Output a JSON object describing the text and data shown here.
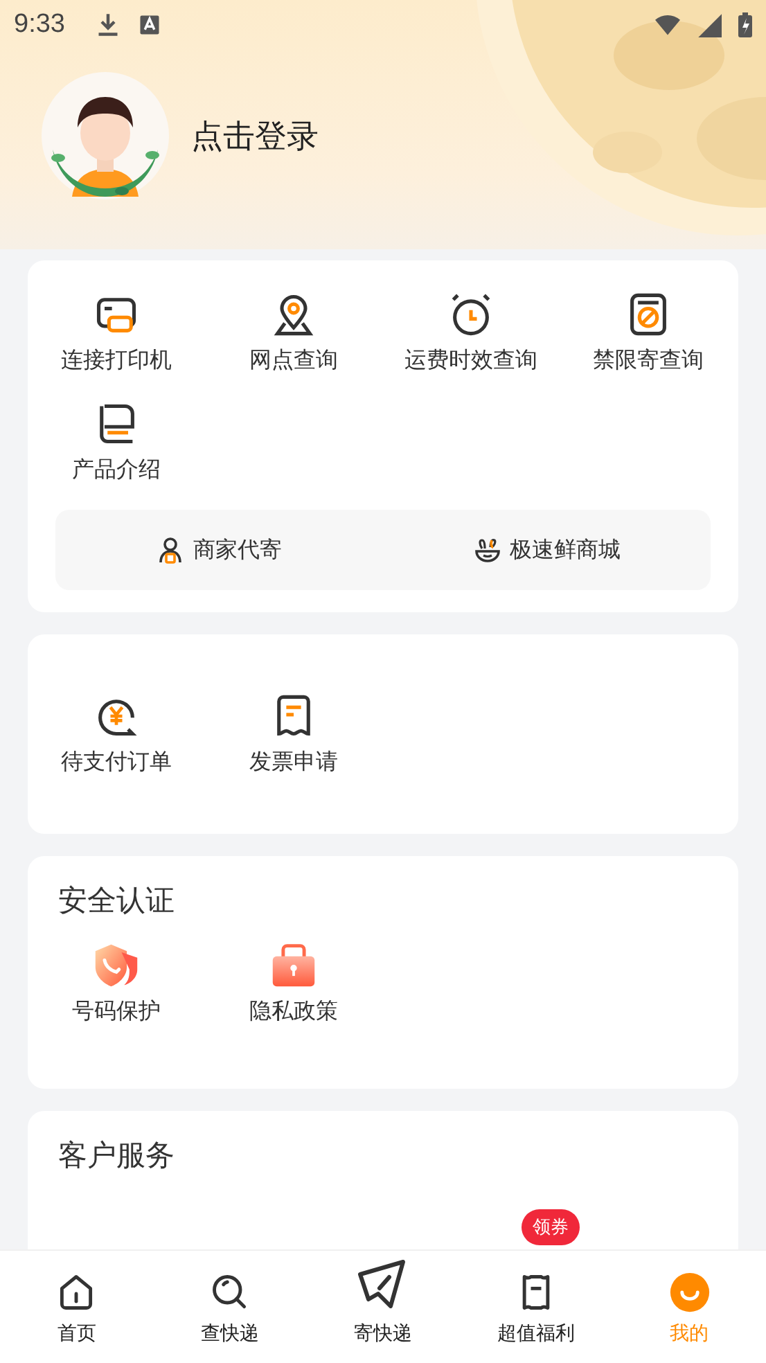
{
  "status_bar": {
    "time": "9:33"
  },
  "profile": {
    "login_label": "点击登录"
  },
  "tools": {
    "items": [
      {
        "label": "连接打印机"
      },
      {
        "label": "网点查询"
      },
      {
        "label": "运费时效查询"
      },
      {
        "label": "禁限寄查询"
      },
      {
        "label": "产品介绍"
      }
    ],
    "links": [
      {
        "label": "商家代寄"
      },
      {
        "label": "极速鲜商城"
      }
    ]
  },
  "orders": {
    "items": [
      {
        "label": "待支付订单"
      },
      {
        "label": "发票申请"
      }
    ]
  },
  "security": {
    "title": "安全认证",
    "items": [
      {
        "label": "号码保护"
      },
      {
        "label": "隐私政策"
      }
    ]
  },
  "service": {
    "title": "客户服务"
  },
  "tab_bar": [
    {
      "label": "首页",
      "selected": false
    },
    {
      "label": "查快递",
      "selected": false
    },
    {
      "label": "寄快递",
      "selected": false
    },
    {
      "label": "超值福利",
      "selected": false,
      "badge": "领券"
    },
    {
      "label": "我的",
      "selected": true
    }
  ]
}
